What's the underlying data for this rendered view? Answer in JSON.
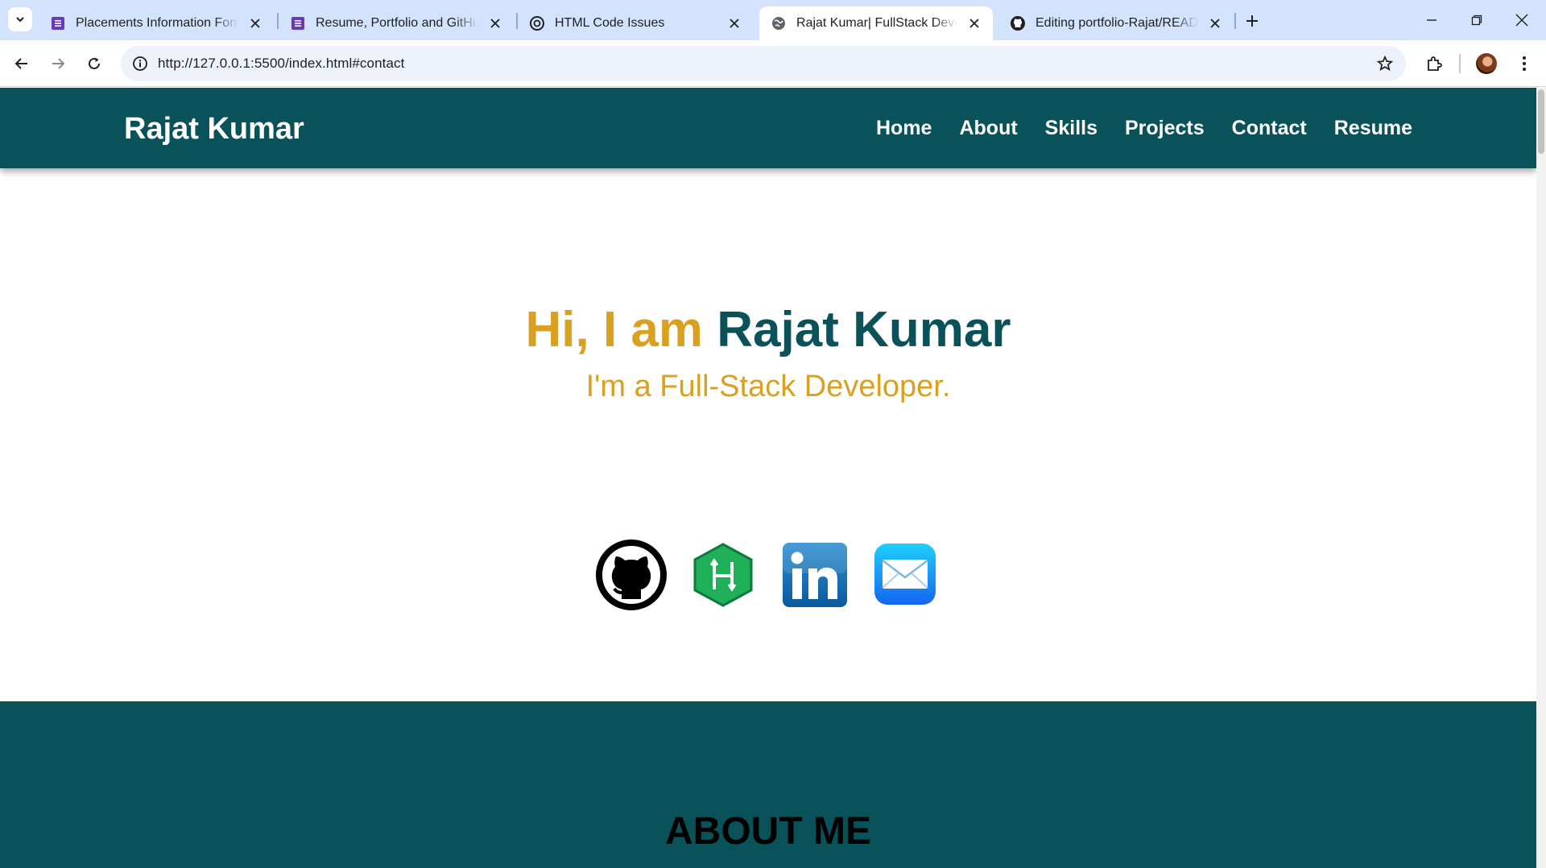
{
  "browser": {
    "tabs": [
      {
        "title": "Placements Information Form -",
        "icon": "forms-icon"
      },
      {
        "title": "Resume, Portfolio and GitHub",
        "icon": "forms-icon"
      },
      {
        "title": "HTML Code Issues",
        "icon": "chatgpt-icon"
      },
      {
        "title": "Rajat Kumar| FullStack Develope",
        "icon": "globe-icon",
        "active": true
      },
      {
        "title": "Editing portfolio-Rajat/README",
        "icon": "github-icon"
      }
    ],
    "url": "http://127.0.0.1:5500/index.html#contact"
  },
  "site": {
    "brand": "Rajat Kumar",
    "nav": [
      "Home",
      "About",
      "Skills",
      "Projects",
      "Contact",
      "Resume"
    ],
    "hero": {
      "greeting": "Hi, I am",
      "name": "Rajat Kumar",
      "subtitle": "I'm a Full-Stack Developer."
    },
    "socials": [
      "github-icon",
      "hackerrank-icon",
      "linkedin-icon",
      "mail-icon"
    ],
    "about_title": "ABOUT ME"
  },
  "colors": {
    "brand_teal": "#0a525a",
    "accent_gold": "#d9a022",
    "tabbar": "#d3e3fd"
  }
}
